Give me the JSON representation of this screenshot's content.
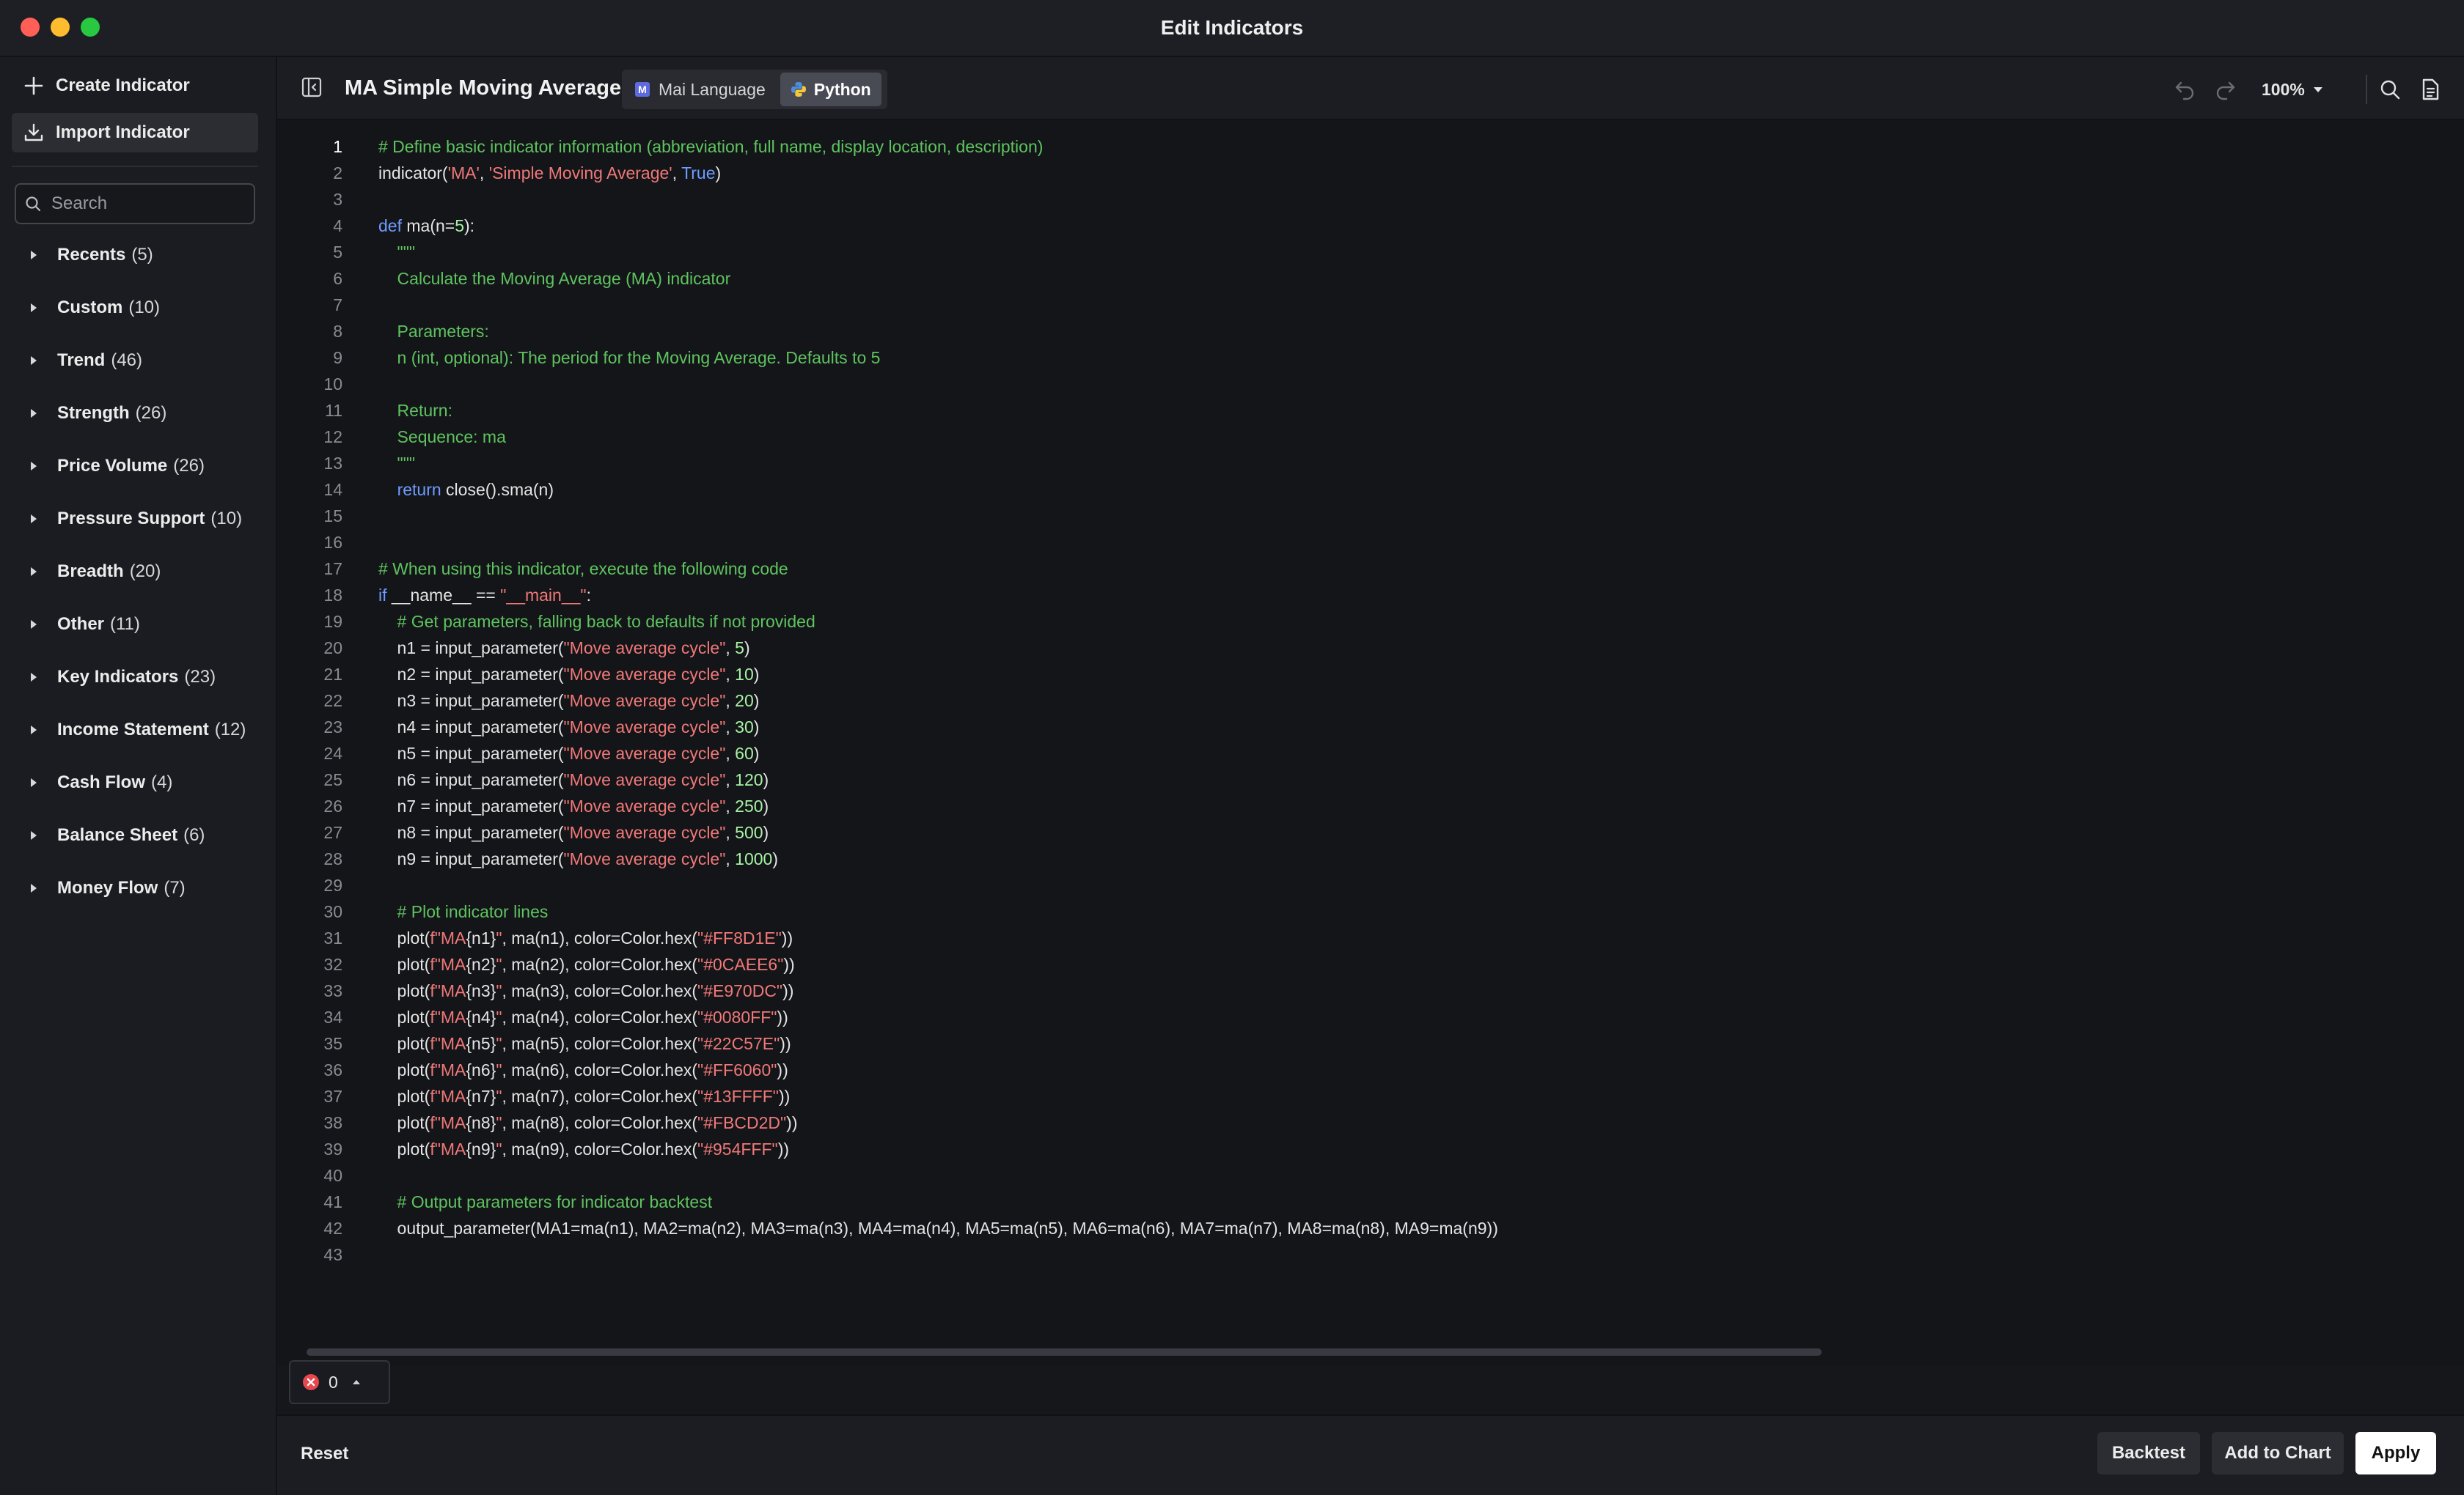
{
  "window": {
    "title": "Edit Indicators"
  },
  "sidebar": {
    "create_label": "Create Indicator",
    "import_label": "Import Indicator",
    "search_placeholder": "Search",
    "categories": [
      {
        "name": "Recents",
        "count": "(5)"
      },
      {
        "name": "Custom",
        "count": "(10)"
      },
      {
        "name": "Trend",
        "count": "(46)"
      },
      {
        "name": "Strength",
        "count": "(26)"
      },
      {
        "name": "Price Volume",
        "count": "(26)"
      },
      {
        "name": "Pressure Support",
        "count": "(10)"
      },
      {
        "name": "Breadth",
        "count": "(20)"
      },
      {
        "name": "Other",
        "count": "(11)"
      },
      {
        "name": "Key Indicators",
        "count": "(23)"
      },
      {
        "name": "Income Statement",
        "count": "(12)"
      },
      {
        "name": "Cash Flow",
        "count": "(4)"
      },
      {
        "name": "Balance Sheet",
        "count": "(6)"
      },
      {
        "name": "Money Flow",
        "count": "(7)"
      }
    ]
  },
  "editor": {
    "title": "MA Simple Moving Average",
    "lang_tabs": [
      {
        "label": "Mai Language",
        "badge": "M"
      },
      {
        "label": "Python"
      }
    ],
    "active_lang": "Python",
    "zoom": "100%",
    "active_line": 1,
    "code_lines": [
      [
        [
          "# Define basic indicator information (abbreviation, full name, display location, description)",
          "comment"
        ]
      ],
      [
        [
          "indicator(",
          ""
        ],
        [
          "'MA'",
          "string"
        ],
        [
          ", ",
          ""
        ],
        [
          "'Simple Moving Average'",
          "string"
        ],
        [
          ", ",
          ""
        ],
        [
          "True",
          "keyword"
        ],
        [
          ")",
          ""
        ]
      ],
      [],
      [
        [
          "def",
          "keyword"
        ],
        [
          " ma(n=",
          ""
        ],
        [
          "5",
          "number"
        ],
        [
          "):",
          ""
        ]
      ],
      [
        [
          "    \"\"\"",
          "comment"
        ]
      ],
      [
        [
          "    Calculate the Moving Average (MA) indicator",
          "comment"
        ]
      ],
      [],
      [
        [
          "    Parameters:",
          "comment"
        ]
      ],
      [
        [
          "    n (int, optional): The period for the Moving Average. Defaults to 5",
          "comment"
        ]
      ],
      [],
      [
        [
          "    Return:",
          "comment"
        ]
      ],
      [
        [
          "    Sequence: ma",
          "comment"
        ]
      ],
      [
        [
          "    \"\"\"",
          "comment"
        ]
      ],
      [
        [
          "    ",
          ""
        ],
        [
          "return",
          "keyword"
        ],
        [
          " close().sma(n)",
          ""
        ]
      ],
      [],
      [],
      [
        [
          "# When using this indicator, execute the following code",
          "comment"
        ]
      ],
      [
        [
          "if",
          "keyword"
        ],
        [
          " __name__ == ",
          ""
        ],
        [
          "\"__main__\"",
          "string"
        ],
        [
          ":",
          ""
        ]
      ],
      [
        [
          "    # Get parameters, falling back to defaults if not provided",
          "comment"
        ]
      ],
      [
        [
          "    n1 = input_parameter(",
          ""
        ],
        [
          "\"Move average cycle\"",
          "string"
        ],
        [
          ", ",
          ""
        ],
        [
          "5",
          "number"
        ],
        [
          ")",
          ""
        ]
      ],
      [
        [
          "    n2 = input_parameter(",
          ""
        ],
        [
          "\"Move average cycle\"",
          "string"
        ],
        [
          ", ",
          ""
        ],
        [
          "10",
          "number"
        ],
        [
          ")",
          ""
        ]
      ],
      [
        [
          "    n3 = input_parameter(",
          ""
        ],
        [
          "\"Move average cycle\"",
          "string"
        ],
        [
          ", ",
          ""
        ],
        [
          "20",
          "number"
        ],
        [
          ")",
          ""
        ]
      ],
      [
        [
          "    n4 = input_parameter(",
          ""
        ],
        [
          "\"Move average cycle\"",
          "string"
        ],
        [
          ", ",
          ""
        ],
        [
          "30",
          "number"
        ],
        [
          ")",
          ""
        ]
      ],
      [
        [
          "    n5 = input_parameter(",
          ""
        ],
        [
          "\"Move average cycle\"",
          "string"
        ],
        [
          ", ",
          ""
        ],
        [
          "60",
          "number"
        ],
        [
          ")",
          ""
        ]
      ],
      [
        [
          "    n6 = input_parameter(",
          ""
        ],
        [
          "\"Move average cycle\"",
          "string"
        ],
        [
          ", ",
          ""
        ],
        [
          "120",
          "number"
        ],
        [
          ")",
          ""
        ]
      ],
      [
        [
          "    n7 = input_parameter(",
          ""
        ],
        [
          "\"Move average cycle\"",
          "string"
        ],
        [
          ", ",
          ""
        ],
        [
          "250",
          "number"
        ],
        [
          ")",
          ""
        ]
      ],
      [
        [
          "    n8 = input_parameter(",
          ""
        ],
        [
          "\"Move average cycle\"",
          "string"
        ],
        [
          ", ",
          ""
        ],
        [
          "500",
          "number"
        ],
        [
          ")",
          ""
        ]
      ],
      [
        [
          "    n9 = input_parameter(",
          ""
        ],
        [
          "\"Move average cycle\"",
          "string"
        ],
        [
          ", ",
          ""
        ],
        [
          "1000",
          "number"
        ],
        [
          ")",
          ""
        ]
      ],
      [],
      [
        [
          "    # Plot indicator lines",
          "comment"
        ]
      ],
      [
        [
          "    plot(",
          ""
        ],
        [
          "f\"MA",
          "string"
        ],
        [
          "{n1}",
          ""
        ],
        [
          "\"",
          "string"
        ],
        [
          ", ma(n1), color=Color.hex(",
          ""
        ],
        [
          "\"#FF8D1E\"",
          "string"
        ],
        [
          "))",
          ""
        ]
      ],
      [
        [
          "    plot(",
          ""
        ],
        [
          "f\"MA",
          "string"
        ],
        [
          "{n2}",
          ""
        ],
        [
          "\"",
          "string"
        ],
        [
          ", ma(n2), color=Color.hex(",
          ""
        ],
        [
          "\"#0CAEE6\"",
          "string"
        ],
        [
          "))",
          ""
        ]
      ],
      [
        [
          "    plot(",
          ""
        ],
        [
          "f\"MA",
          "string"
        ],
        [
          "{n3}",
          ""
        ],
        [
          "\"",
          "string"
        ],
        [
          ", ma(n3), color=Color.hex(",
          ""
        ],
        [
          "\"#E970DC\"",
          "string"
        ],
        [
          "))",
          ""
        ]
      ],
      [
        [
          "    plot(",
          ""
        ],
        [
          "f\"MA",
          "string"
        ],
        [
          "{n4}",
          ""
        ],
        [
          "\"",
          "string"
        ],
        [
          ", ma(n4), color=Color.hex(",
          ""
        ],
        [
          "\"#0080FF\"",
          "string"
        ],
        [
          "))",
          ""
        ]
      ],
      [
        [
          "    plot(",
          ""
        ],
        [
          "f\"MA",
          "string"
        ],
        [
          "{n5}",
          ""
        ],
        [
          "\"",
          "string"
        ],
        [
          ", ma(n5), color=Color.hex(",
          ""
        ],
        [
          "\"#22C57E\"",
          "string"
        ],
        [
          "))",
          ""
        ]
      ],
      [
        [
          "    plot(",
          ""
        ],
        [
          "f\"MA",
          "string"
        ],
        [
          "{n6}",
          ""
        ],
        [
          "\"",
          "string"
        ],
        [
          ", ma(n6), color=Color.hex(",
          ""
        ],
        [
          "\"#FF6060\"",
          "string"
        ],
        [
          "))",
          ""
        ]
      ],
      [
        [
          "    plot(",
          ""
        ],
        [
          "f\"MA",
          "string"
        ],
        [
          "{n7}",
          ""
        ],
        [
          "\"",
          "string"
        ],
        [
          ", ma(n7), color=Color.hex(",
          ""
        ],
        [
          "\"#13FFFF\"",
          "string"
        ],
        [
          "))",
          ""
        ]
      ],
      [
        [
          "    plot(",
          ""
        ],
        [
          "f\"MA",
          "string"
        ],
        [
          "{n8}",
          ""
        ],
        [
          "\"",
          "string"
        ],
        [
          ", ma(n8), color=Color.hex(",
          ""
        ],
        [
          "\"#FBCD2D\"",
          "string"
        ],
        [
          "))",
          ""
        ]
      ],
      [
        [
          "    plot(",
          ""
        ],
        [
          "f\"MA",
          "string"
        ],
        [
          "{n9}",
          ""
        ],
        [
          "\"",
          "string"
        ],
        [
          ", ma(n9), color=Color.hex(",
          ""
        ],
        [
          "\"#954FFF\"",
          "string"
        ],
        [
          "))",
          ""
        ]
      ],
      [],
      [
        [
          "    # Output parameters for indicator backtest",
          "comment"
        ]
      ],
      [
        [
          "    output_parameter(MA1=ma(n1), MA2=ma(n2), MA3=ma(n3), MA4=ma(n4), MA5=ma(n5), MA6=ma(n6), MA7=ma(n7), MA8=ma(n8), MA9=ma(n9))",
          ""
        ]
      ],
      []
    ]
  },
  "problems": {
    "count": "0"
  },
  "footer": {
    "reset_label": "Reset",
    "backtest_label": "Backtest",
    "add_to_chart_label": "Add to Chart",
    "apply_label": "Apply"
  },
  "colors": {
    "comment": "#5ec35f",
    "string": "#f07878",
    "keyword": "#6e9cff",
    "number": "#a7f2a4",
    "error": "#e5484d"
  }
}
